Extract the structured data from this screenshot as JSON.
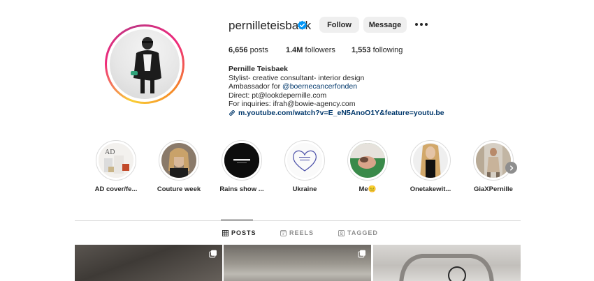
{
  "profile": {
    "username": "pernilleteisbaek",
    "follow_label": "Follow",
    "message_label": "Message",
    "stats": {
      "posts_count": "6,656",
      "posts_label": "posts",
      "followers_count": "1.4M",
      "followers_label": "followers",
      "following_count": "1,553",
      "following_label": "following"
    },
    "bio": {
      "name": "Pernille Teisbaek",
      "line1": "Stylist- creative consultant- interior design",
      "line2_prefix": "Ambassador for ",
      "line2_mention": "@boernecancerfonden",
      "line3": "Direct: pt@lookdepernille.com",
      "line4": "For inquiries: ifrah@bowie-agency.com",
      "link": "m.youtube.com/watch?v=E_eN5AnoO1Y&feature=youtu.be"
    }
  },
  "highlights": [
    {
      "label": "AD cover/fe..."
    },
    {
      "label": "Couture week"
    },
    {
      "label": "Rains show ..."
    },
    {
      "label": "Ukraine"
    },
    {
      "label": "Me😑"
    },
    {
      "label": "Onetakewit..."
    },
    {
      "label": "GiaXPernille"
    }
  ],
  "tabs": {
    "posts": "POSTS",
    "reels": "REELS",
    "tagged": "TAGGED"
  },
  "colors": {
    "link": "#00376b",
    "verified": "#0095f6",
    "button_bg": "#efefef"
  },
  "icons": {
    "verified": "verified-badge-icon",
    "more": "more-options-icon",
    "link": "link-icon",
    "next": "chevron-right-icon",
    "posts": "grid-icon",
    "reels": "reels-icon",
    "tagged": "tagged-icon",
    "multi": "carousel-icon"
  }
}
